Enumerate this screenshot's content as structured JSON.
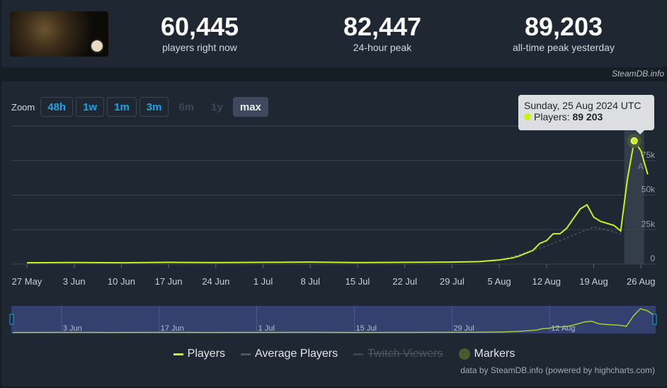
{
  "header": {
    "stats": [
      {
        "value": "60,445",
        "label": "players right now"
      },
      {
        "value": "82,447",
        "label": "24-hour peak"
      },
      {
        "value": "89,203",
        "label": "all-time peak yesterday"
      }
    ],
    "credit": "SteamDB.info"
  },
  "zoom": {
    "label": "Zoom",
    "buttons": [
      {
        "label": "48h",
        "state": "enabled"
      },
      {
        "label": "1w",
        "state": "enabled"
      },
      {
        "label": "1m",
        "state": "enabled"
      },
      {
        "label": "3m",
        "state": "enabled"
      },
      {
        "label": "6m",
        "state": "disabled"
      },
      {
        "label": "1y",
        "state": "disabled"
      },
      {
        "label": "max",
        "state": "active"
      }
    ]
  },
  "tooltip": {
    "date": "Sunday, 25 Aug 2024 UTC",
    "series": "Players: ",
    "value": "89 203"
  },
  "colors": {
    "players": "#c8f21c",
    "average": "#4a5566",
    "navigator_bg": "#34406e"
  },
  "chart_data": {
    "type": "line",
    "x_ticks": [
      "27 May",
      "3 Jun",
      "10 Jun",
      "17 Jun",
      "24 Jun",
      "1 Jul",
      "8 Jul",
      "15 Jul",
      "22 Jul",
      "29 Jul",
      "5 Aug",
      "12 Aug",
      "19 Aug",
      "26 Aug"
    ],
    "y_ticks": [
      "0",
      "25k",
      "50k",
      "75k"
    ],
    "ylim": [
      0,
      100000
    ],
    "grid": true,
    "marker_label": "A",
    "series": [
      {
        "name": "Players",
        "points": [
          [
            "2024-05-27",
            1000
          ],
          [
            "2024-06-03",
            1200
          ],
          [
            "2024-06-10",
            1000
          ],
          [
            "2024-06-17",
            1300
          ],
          [
            "2024-06-24",
            1100
          ],
          [
            "2024-07-01",
            1300
          ],
          [
            "2024-07-08",
            1500
          ],
          [
            "2024-07-15",
            1100
          ],
          [
            "2024-07-22",
            1300
          ],
          [
            "2024-07-29",
            1500
          ],
          [
            "2024-08-02",
            1800
          ],
          [
            "2024-08-05",
            3000
          ],
          [
            "2024-08-07",
            4500
          ],
          [
            "2024-08-08",
            6000
          ],
          [
            "2024-08-09",
            8000
          ],
          [
            "2024-08-10",
            10000
          ],
          [
            "2024-08-11",
            15000
          ],
          [
            "2024-08-12",
            17000
          ],
          [
            "2024-08-13",
            22000
          ],
          [
            "2024-08-14",
            22000
          ],
          [
            "2024-08-15",
            26000
          ],
          [
            "2024-08-16",
            33000
          ],
          [
            "2024-08-17",
            40000
          ],
          [
            "2024-08-18",
            43000
          ],
          [
            "2024-08-19",
            34000
          ],
          [
            "2024-08-20",
            31000
          ],
          [
            "2024-08-21",
            29500
          ],
          [
            "2024-08-22",
            28000
          ],
          [
            "2024-08-23",
            24000
          ],
          [
            "2024-08-24",
            62000
          ],
          [
            "2024-08-25",
            89203
          ],
          [
            "2024-08-26",
            82000
          ],
          [
            "2024-08-27",
            65000
          ]
        ]
      },
      {
        "name": "Average Players",
        "points": [
          [
            "2024-05-27",
            900
          ],
          [
            "2024-07-29",
            1300
          ],
          [
            "2024-08-05",
            2500
          ],
          [
            "2024-08-12",
            13000
          ],
          [
            "2024-08-19",
            27000
          ],
          [
            "2024-08-23",
            22000
          ]
        ]
      }
    ],
    "navigator_ticks": [
      "3 Jun",
      "17 Jun",
      "1 Jul",
      "15 Jul",
      "29 Jul",
      "12 Aug"
    ],
    "legend": [
      {
        "label": "Players",
        "visible": true
      },
      {
        "label": "Average Players",
        "visible": true
      },
      {
        "label": "Twitch Viewers",
        "visible": false
      },
      {
        "label": "Markers",
        "visible": true
      }
    ]
  },
  "source": "data by SteamDB.info (powered by highcharts.com)"
}
